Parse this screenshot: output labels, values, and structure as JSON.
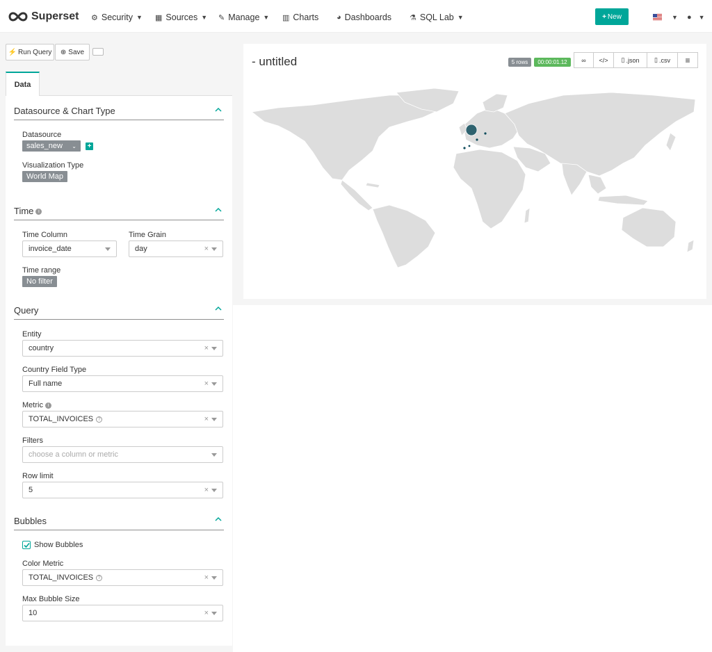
{
  "brand": {
    "name": "Superset"
  },
  "nav": {
    "security": "Security",
    "sources": "Sources",
    "manage": "Manage",
    "charts": "Charts",
    "dashboards": "Dashboards",
    "sqllab": "SQL Lab",
    "new_btn": "New"
  },
  "toolbar": {
    "run_query": "Run Query",
    "save": "Save"
  },
  "tabs": {
    "data": "Data"
  },
  "datasource_section": {
    "title": "Datasource & Chart Type",
    "datasource_label": "Datasource",
    "datasource_value": "sales_new",
    "viz_label": "Visualization Type",
    "viz_value": "World Map"
  },
  "time_section": {
    "title": "Time",
    "time_column_label": "Time Column",
    "time_column_value": "invoice_date",
    "time_grain_label": "Time Grain",
    "time_grain_value": "day",
    "time_range_label": "Time range",
    "time_range_value": "No filter"
  },
  "query_section": {
    "title": "Query",
    "entity_label": "Entity",
    "entity_value": "country",
    "country_field_label": "Country Field Type",
    "country_field_value": "Full name",
    "metric_label": "Metric",
    "metric_value": "TOTAL_INVOICES",
    "filters_label": "Filters",
    "filters_placeholder": "choose a column or metric",
    "row_limit_label": "Row limit",
    "row_limit_value": "5"
  },
  "bubbles_section": {
    "title": "Bubbles",
    "show_bubbles_label": "Show Bubbles",
    "show_bubbles_checked": true,
    "color_metric_label": "Color Metric",
    "color_metric_value": "TOTAL_INVOICES",
    "max_bubble_label": "Max Bubble Size",
    "max_bubble_value": "10"
  },
  "chart": {
    "title": "- untitled",
    "rows_badge": "5 rows",
    "timer_badge": "00:00:01.12",
    "json_btn": ".json",
    "csv_btn": ".csv"
  },
  "colors": {
    "accent": "#00a699",
    "timer": "#5cb85c",
    "badge": "#888e93",
    "land": "#dddddd",
    "bubble": "#0f4c5c"
  }
}
